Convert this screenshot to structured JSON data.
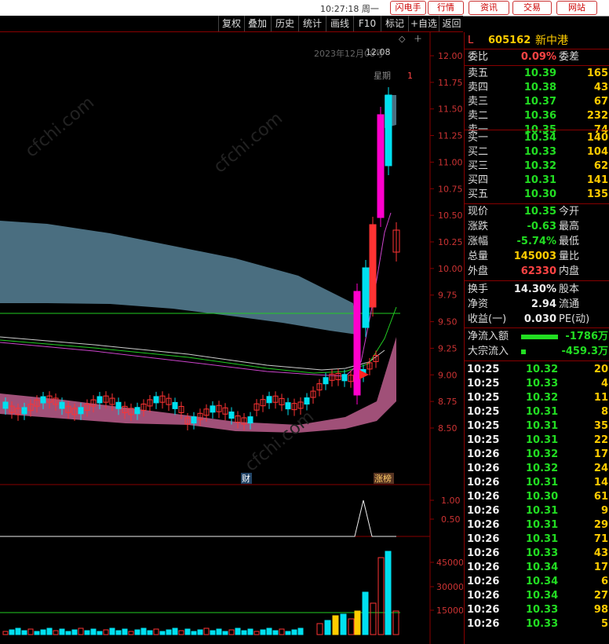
{
  "titlebar": {
    "time": "10:27:18 周一",
    "buttons": [
      "闪电手",
      "行情",
      "资讯",
      "交易",
      "网站"
    ]
  },
  "toolbar": {
    "items": [
      "复权",
      "叠加",
      "历史",
      "统计",
      "画线",
      "F10",
      "标记",
      "+自选",
      "返回"
    ]
  },
  "chart": {
    "date_label": "2023年12月08号",
    "weekday_label": "星期",
    "weekday_num": "1",
    "peak_price_label": "12.08",
    "price_axis": [
      "12.00",
      "11.75",
      "11.50",
      "11.25",
      "11.00",
      "10.75",
      "10.50",
      "10.25",
      "10.00",
      "9.75",
      "9.50",
      "9.25",
      "9.00",
      "8.75",
      "8.50"
    ],
    "badge_cai": "财",
    "badge_zhangbang": "涨榜",
    "ind_axis": [
      "1.00",
      "0.50"
    ],
    "vol_axis": [
      "45000",
      "30000",
      "15000"
    ],
    "watermark": "cfchi.com"
  },
  "quote": {
    "market": "L",
    "code": "605162",
    "name": "新中港",
    "weibi": {
      "label": "委比",
      "value": "0.09%",
      "label2": "委差"
    },
    "asks": [
      {
        "label": "卖五",
        "price": "10.39",
        "vol": "165"
      },
      {
        "label": "卖四",
        "price": "10.38",
        "vol": "43"
      },
      {
        "label": "卖三",
        "price": "10.37",
        "vol": "67"
      },
      {
        "label": "卖二",
        "price": "10.36",
        "vol": "232"
      },
      {
        "label": "卖一",
        "price": "10.35",
        "vol": "74"
      }
    ],
    "bids": [
      {
        "label": "买一",
        "price": "10.34",
        "vol": "140"
      },
      {
        "label": "买二",
        "price": "10.33",
        "vol": "104"
      },
      {
        "label": "买三",
        "price": "10.32",
        "vol": "62"
      },
      {
        "label": "买四",
        "price": "10.31",
        "vol": "141"
      },
      {
        "label": "买五",
        "price": "10.30",
        "vol": "135"
      }
    ],
    "stats": [
      {
        "label": "现价",
        "value": "10.35",
        "label2": "今开",
        "cls": "green"
      },
      {
        "label": "涨跌",
        "value": "-0.63",
        "label2": "最高",
        "cls": "green"
      },
      {
        "label": "涨幅",
        "value": "-5.74%",
        "label2": "最低",
        "cls": "green"
      },
      {
        "label": "总量",
        "value": "145003",
        "label2": "量比",
        "cls": "yellow"
      },
      {
        "label": "外盘",
        "value": "62330",
        "label2": "内盘",
        "cls": "red"
      }
    ],
    "fin": [
      {
        "label": "换手",
        "value": "14.30%",
        "label2": "股本",
        "cls": "white"
      },
      {
        "label": "净资",
        "value": "2.94",
        "label2": "流通",
        "cls": "white"
      },
      {
        "label": "收益(一)",
        "value": "0.030",
        "label2": "PE(动)",
        "cls": "white"
      }
    ],
    "flow": [
      {
        "label": "净流入额",
        "value": "-1786万",
        "fill": 0.9
      },
      {
        "label": "大宗流入",
        "value": "-459.3万",
        "fill": 0.12
      }
    ],
    "ticks": [
      {
        "time": "10:25",
        "price": "10.32",
        "vol": "20"
      },
      {
        "time": "10:25",
        "price": "10.33",
        "vol": "4"
      },
      {
        "time": "10:25",
        "price": "10.32",
        "vol": "11"
      },
      {
        "time": "10:25",
        "price": "10.31",
        "vol": "8"
      },
      {
        "time": "10:25",
        "price": "10.31",
        "vol": "35"
      },
      {
        "time": "10:25",
        "price": "10.31",
        "vol": "22"
      },
      {
        "time": "10:26",
        "price": "10.32",
        "vol": "17"
      },
      {
        "time": "10:26",
        "price": "10.32",
        "vol": "24"
      },
      {
        "time": "10:26",
        "price": "10.31",
        "vol": "14"
      },
      {
        "time": "10:26",
        "price": "10.30",
        "vol": "61"
      },
      {
        "time": "10:26",
        "price": "10.31",
        "vol": "9"
      },
      {
        "time": "10:26",
        "price": "10.31",
        "vol": "29"
      },
      {
        "time": "10:26",
        "price": "10.31",
        "vol": "71"
      },
      {
        "time": "10:26",
        "price": "10.33",
        "vol": "43"
      },
      {
        "time": "10:26",
        "price": "10.34",
        "vol": "17"
      },
      {
        "time": "10:26",
        "price": "10.34",
        "vol": "6"
      },
      {
        "time": "10:26",
        "price": "10.34",
        "vol": "27"
      },
      {
        "time": "10:26",
        "price": "10.33",
        "vol": "98"
      },
      {
        "time": "10:26",
        "price": "10.33",
        "vol": "5"
      }
    ]
  },
  "colors": {
    "up": "#ff3333",
    "down": "#00e0f0",
    "limit": "#ff00cc",
    "band": "#a05078",
    "cloud": "#4a6e80"
  }
}
